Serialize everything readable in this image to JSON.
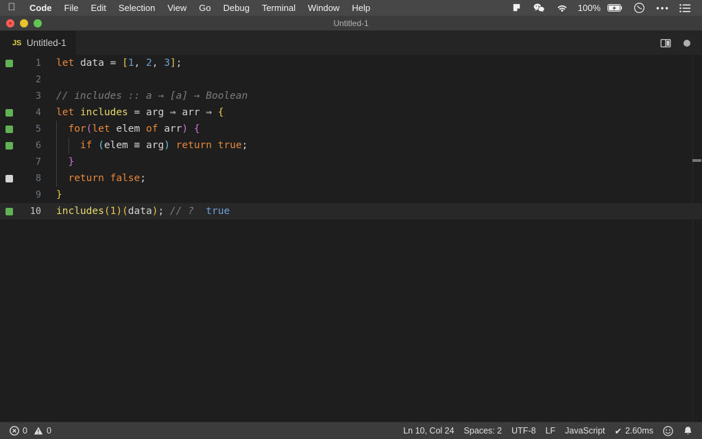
{
  "menubar": {
    "apple_icon": "apple-icon",
    "items": [
      {
        "label": "Code",
        "bold": true
      },
      {
        "label": "File",
        "bold": false
      },
      {
        "label": "Edit",
        "bold": false
      },
      {
        "label": "Selection",
        "bold": false
      },
      {
        "label": "View",
        "bold": false
      },
      {
        "label": "Go",
        "bold": false
      },
      {
        "label": "Debug",
        "bold": false
      },
      {
        "label": "Terminal",
        "bold": false
      },
      {
        "label": "Window",
        "bold": false
      },
      {
        "label": "Help",
        "bold": false
      }
    ],
    "tray": {
      "flag_icon": "flag-icon",
      "wechat_icon": "wechat-icon",
      "wifi_icon": "wifi-icon",
      "battery_percent": "100%",
      "battery_icon": "battery-charging-icon",
      "clock_icon": "clock-icon",
      "more_icon": "ellipsis-icon",
      "controlcenter_icon": "list-icon"
    }
  },
  "window": {
    "title": "Untitled-1",
    "traffic_lights": [
      "close-button",
      "minimize-button",
      "zoom-button"
    ]
  },
  "tabbar": {
    "tab": {
      "badge": "JS",
      "label": "Untitled-1"
    },
    "split_editor_icon": "split-editor-icon",
    "dirty_indicator": "unsaved-dot-icon"
  },
  "editor": {
    "active_line": 10,
    "lines": [
      {
        "n": "1",
        "bp": "on",
        "active": false
      },
      {
        "n": "2",
        "bp": "none",
        "active": false
      },
      {
        "n": "3",
        "bp": "none",
        "active": false
      },
      {
        "n": "4",
        "bp": "on",
        "active": false
      },
      {
        "n": "5",
        "bp": "on",
        "active": false
      },
      {
        "n": "6",
        "bp": "on",
        "active": false
      },
      {
        "n": "7",
        "bp": "none",
        "active": false
      },
      {
        "n": "8",
        "bp": "off",
        "active": false
      },
      {
        "n": "9",
        "bp": "none",
        "active": false
      },
      {
        "n": "10",
        "bp": "on",
        "active": true
      }
    ],
    "code_text": [
      "let data = [1, 2, 3];",
      "",
      "// includes :: a → [a] → Boolean",
      "let includes = arg ⇒ arr ⇒ {",
      "  for(let elem of arr) {",
      "    if (elem === arg) return true;",
      "  }",
      "  return false;",
      "}",
      "includes(1)(data); // ?  true"
    ],
    "language": "JavaScript"
  },
  "statusbar": {
    "errors_icon": "error-circle-icon",
    "errors": "0",
    "warnings_icon": "warning-triangle-icon",
    "warnings": "0",
    "position": "Ln 10, Col 24",
    "indentation": "Spaces: 2",
    "encoding": "UTF-8",
    "eol": "LF",
    "language": "JavaScript",
    "quokka_check": "✔",
    "quokka_time": "2.60ms",
    "feedback_icon": "smiley-icon",
    "notifications_icon": "bell-icon"
  },
  "colors": {
    "editor_bg": "#1e1e1e",
    "tabbar_bg": "#252526",
    "statusbar_bg": "#3c3c3c",
    "menubar_bg": "#474747",
    "keyword": "#e8883a",
    "number": "#6aa0d8",
    "bracket_yellow": "#e8c84a",
    "bracket_magenta": "#d670d6",
    "bracket_cyan": "#64c8e0",
    "function": "#e8d96b",
    "comment": "#7d7d7d",
    "breakpoint_active": "#60b255"
  }
}
